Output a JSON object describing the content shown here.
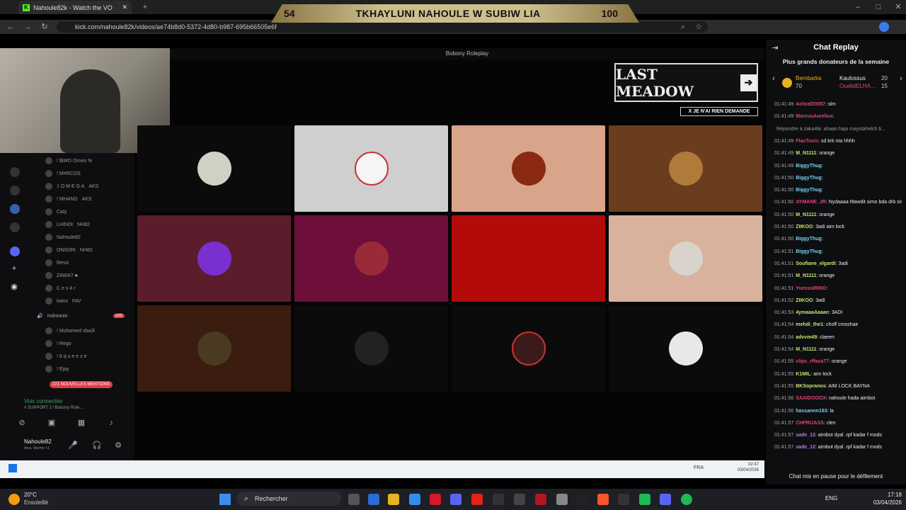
{
  "browser": {
    "tab_title": "Nahoule82k - Watch the VO",
    "url": "kick.com/nahoule82k/videos/ae74b8d0-5372-4d80-b987-695b66505e6f"
  },
  "scoreboard": {
    "left": "54",
    "title": "TKHAYLUNI NAHOULE W SUBIW LIA",
    "right": "100"
  },
  "discord": {
    "window_title": "Bobony Roleplay",
    "members": [
      "! $IMO Ornes %",
      "! M≠RCOS",
      "1 O M E G A",
      "! MHAND",
      "Caty",
      "LHINDI",
      "Nahoule82",
      "ONIGIRI",
      "Reviz",
      "ZAWA? ♣",
      "C e s 4 r",
      "twins"
    ],
    "channel": "mdmonin",
    "channel_badge": "109",
    "channel_members": [
      "! Mohamed sba3l",
      "! Rego",
      "! 8 q u e e z e",
      "! Ejay"
    ],
    "mentions": "221 NOUVELLES MENTIONS",
    "voice_status": "Voix connectée",
    "voice_channel": "# SUPPORT 2 / Bobony Role...",
    "user": "Nahoule82",
    "user_status": "Arys, Stormy +1",
    "tag_aks": "AKS",
    "tag_nh82": "NH82",
    "tag_fav": "FAV"
  },
  "overlay": {
    "logo": "LAST MEADOW",
    "banner": "X JE N'AI RIEN DEMANDE"
  },
  "tiles": [
    "#0b0b0b",
    "#cfcfcf",
    "#d9a58a",
    "#6a3d1f",
    "#5b1d2b",
    "#6d0f3a",
    "#b30a0a",
    "#d8b29c",
    "#3b1c10",
    "#0b0b0b",
    "#0b0b0b",
    "#0b0b0b"
  ],
  "taskbar_small": {
    "lang": "FRA",
    "time": "02:47",
    "date": "03/04/2026"
  },
  "chat": {
    "title": "Chat Replay",
    "subtitle": "Plus grands donateurs de la semaine",
    "donors": [
      {
        "name": "Bembarka",
        "amount": "70"
      },
      {
        "name": "Kaulossus",
        "amount": "20"
      },
      {
        "name": "OualidELHA...",
        "amount": "15"
      }
    ],
    "messages": [
      {
        "t": "01:41:49",
        "u": "Achraf20057",
        "c": "#e0457b",
        "m": "slm"
      },
      {
        "t": "01:41:49",
        "u": "MarcusAurelius",
        "c": "#e0457b",
        "m": ""
      },
      {
        "t": "",
        "u": "",
        "c": "#aaa",
        "m": "Répondre à zaka4la: ahaan haja maystahelch b..."
      },
      {
        "t": "01:41:49",
        "u": "FlaxToxic",
        "c": "#e0457b",
        "m": "sd krk nta hhhh"
      },
      {
        "t": "01:41:49",
        "u": "M_N1111",
        "c": "#c6e36b",
        "m": "orange"
      },
      {
        "t": "01:41:49",
        "u": "BiggyThug",
        "c": "#75d2f0",
        "m": ""
      },
      {
        "t": "01:41:50",
        "u": "BiggyThug",
        "c": "#75d2f0",
        "m": ""
      },
      {
        "t": "01:41:50",
        "u": "BiggyThug",
        "c": "#75d2f0",
        "m": ""
      },
      {
        "t": "01:41:50",
        "u": "AYMANE_JR",
        "c": "#e0457b",
        "m": "Nydaaaa t9awdit simo bda drb simo"
      },
      {
        "t": "01:41:50",
        "u": "M_N1111",
        "c": "#c6e36b",
        "m": "orange"
      },
      {
        "t": "01:41:50",
        "u": "ZIIKOO",
        "c": "#c6e36b",
        "m": "3adi aim lock"
      },
      {
        "t": "01:41:50",
        "u": "BiggyThug",
        "c": "#75d2f0",
        "m": ""
      },
      {
        "t": "01:41:51",
        "u": "BiggyThug",
        "c": "#75d2f0",
        "m": ""
      },
      {
        "t": "01:41:51",
        "u": "Soufiane_elgardi",
        "c": "#c6e36b",
        "m": "3adi"
      },
      {
        "t": "01:41:51",
        "u": "M_N1111",
        "c": "#c6e36b",
        "m": "orange"
      },
      {
        "t": "01:41:51",
        "u": "YvesssIRINO",
        "c": "#e0457b",
        "m": ""
      },
      {
        "t": "01:41:52",
        "u": "ZIIKOO",
        "c": "#c6e36b",
        "m": "3adi"
      },
      {
        "t": "01:41:53",
        "u": "4ymaaaAaaan",
        "c": "#c6e36b",
        "m": "3ADI"
      },
      {
        "t": "01:41:54",
        "u": "mehdi_the1",
        "c": "#c6e36b",
        "m": "choff crosshair"
      },
      {
        "t": "01:41:54",
        "u": "advvm49",
        "c": "#c6e36b",
        "m": "claeen"
      },
      {
        "t": "01:41:54",
        "u": "M_N1111",
        "c": "#c6e36b",
        "m": "orange"
      },
      {
        "t": "01:41:55",
        "u": "clips_rffasa77",
        "c": "#e0457b",
        "m": "orange"
      },
      {
        "t": "01:41:55",
        "u": "K1MIL",
        "c": "#c6e36b",
        "m": "aim lock"
      },
      {
        "t": "01:41:55",
        "u": "BKSopranos",
        "c": "#c6e36b",
        "m": "AIM LOCK BAYNA"
      },
      {
        "t": "01:41:56",
        "u": "SAAIDOOOX",
        "c": "#e0457b",
        "m": "nahoule hada aimbot"
      },
      {
        "t": "01:41:56",
        "u": "hassannn163",
        "c": "#75d2f0",
        "m": "la"
      },
      {
        "t": "01:41:57",
        "u": "CHFRIJASS",
        "c": "#e0457b",
        "m": "clen"
      },
      {
        "t": "01:41:57",
        "u": "sade_12",
        "c": "#b57bf0",
        "m": "aimbot dyal .rpf kadar f mods"
      },
      {
        "t": "01:41:57",
        "u": "sade_12",
        "c": "#b57bf0",
        "m": "aimbot dyal .rpf kadar f mods"
      }
    ],
    "pause": "Chat mis en pause pour le défilement"
  },
  "taskbar": {
    "weather_temp": "20°C",
    "weather_desc": "Ensoleillé",
    "search": "Rechercher",
    "lang": "ENG",
    "time": "17:18",
    "date": "03/04/2026"
  }
}
